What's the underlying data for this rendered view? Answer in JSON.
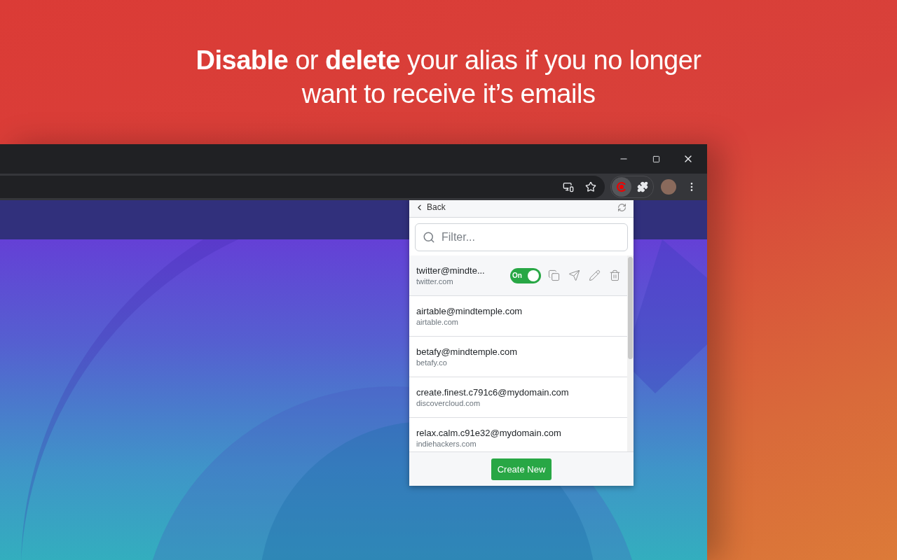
{
  "headline": "**Disable** or **delete** your alias if you no longer want to receive it’s emails",
  "popup": {
    "back": "Back",
    "search": {
      "placeholder": "Filter..."
    },
    "aliases": [
      {
        "email": "twitter@mindte...",
        "domain": "twitter.com",
        "selected": true,
        "toggle": {
          "label": "On",
          "on": true
        }
      },
      {
        "email": "airtable@mindtemple.com",
        "domain": "airtable.com",
        "selected": false
      },
      {
        "email": "betafy@mindtemple.com",
        "domain": "betafy.co",
        "selected": false
      },
      {
        "email": "create.finest.c791c6@mydomain.com",
        "domain": "discovercloud.com",
        "selected": false
      },
      {
        "email": "relax.calm.c91e32@mydomain.com",
        "domain": "indiehackers.com",
        "selected": false
      }
    ],
    "create_button": "Create New"
  }
}
